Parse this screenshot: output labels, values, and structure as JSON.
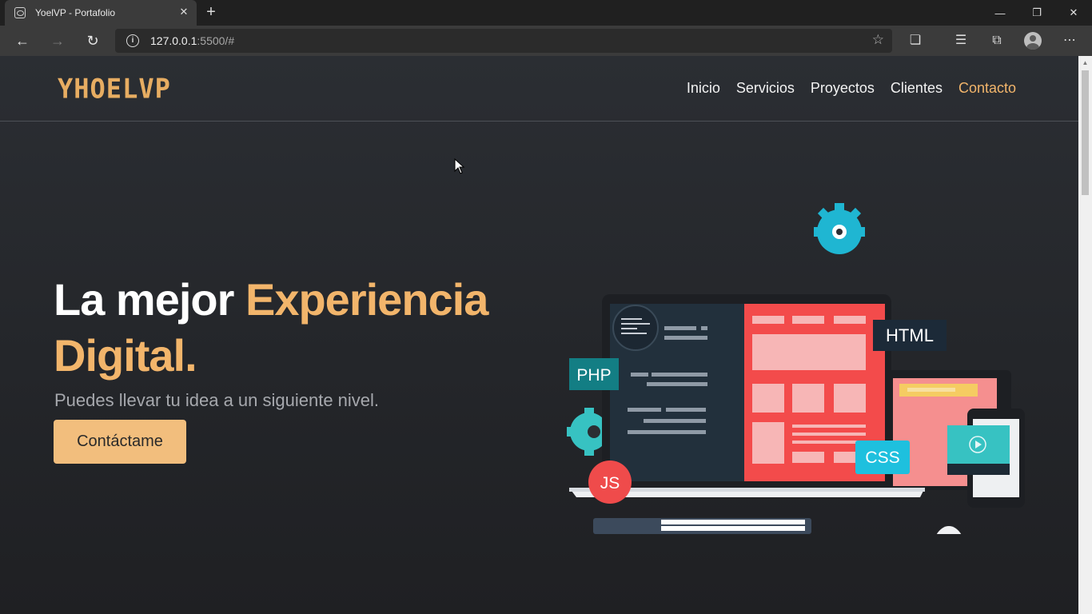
{
  "browser": {
    "tab_title": "YoelVP - Portafolio",
    "url_host": "127.0.0.1",
    "url_rest": ":5500/#"
  },
  "site": {
    "logo": "YHOELVP",
    "nav": [
      "Inicio",
      "Servicios",
      "Proyectos",
      "Clientes",
      "Contacto"
    ],
    "active_nav": "Contacto"
  },
  "hero": {
    "title_white": "La mejor ",
    "title_accent_1": "Experiencia",
    "title_accent_2": "Digital.",
    "subtitle": "Puedes llevar tu idea a un siguiente nivel.",
    "cta": "Contáctame"
  },
  "illustration": {
    "badges": [
      "HTML",
      "PHP",
      "CSS",
      "JS"
    ]
  },
  "colors": {
    "accent": "#f2b56b",
    "button": "#f2be7d",
    "background": "#24262a"
  }
}
